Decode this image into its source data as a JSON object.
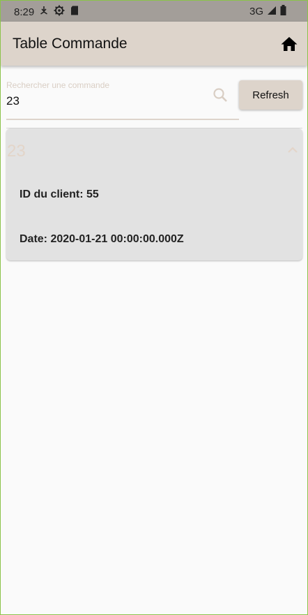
{
  "status_bar": {
    "time": "8:29",
    "network": "3G"
  },
  "app_bar": {
    "title": "Table Commande"
  },
  "search": {
    "label": "Rechercher une commande",
    "value": "23"
  },
  "refresh_label": "Refresh",
  "order": {
    "title": "23",
    "client_line": "ID du client: 55",
    "date_line": "Date: 2020-01-21 00:00:00.000Z"
  },
  "colors": {
    "status_bar": "#a39e99",
    "app_bar": "#ddd4cb",
    "card": "#e2e2e2",
    "order_title": "#e3d5c9"
  },
  "icons": [
    "download-icon",
    "settings-icon",
    "sd-card-icon",
    "signal-icon",
    "battery-icon",
    "home-icon",
    "search-icon",
    "chevron-up-icon"
  ]
}
